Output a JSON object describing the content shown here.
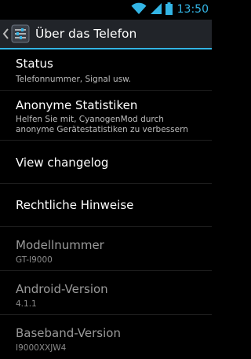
{
  "status_bar": {
    "time": "13:50",
    "icons": [
      "wifi-icon",
      "signal-icon",
      "battery-icon"
    ],
    "accent_color": "#33b5e5"
  },
  "action_bar": {
    "title": "Über das Telefon",
    "icons": [
      "up-caret-icon",
      "settings-app-icon"
    ]
  },
  "preferences": [
    {
      "title": "Status",
      "summary": "Telefonnummer, Signal usw."
    },
    {
      "title": "Anonyme Statistiken",
      "summary": "Helfen Sie mit, CyanogenMod durch anonyme Gerätestatistiken zu verbessern"
    },
    {
      "title": "View changelog"
    },
    {
      "title": "Rechtliche Hinweise"
    },
    {
      "title": "Modellnummer",
      "summary": "GT-I9000"
    },
    {
      "title": "Android-Version",
      "summary": "4.1.1"
    },
    {
      "title": "Baseband-Version",
      "summary": "I9000XXJW4"
    }
  ],
  "colors": {
    "background": "#000000",
    "action_bar": "#212429",
    "accent": "#33b5e5",
    "divider": "#1e1e1e"
  }
}
